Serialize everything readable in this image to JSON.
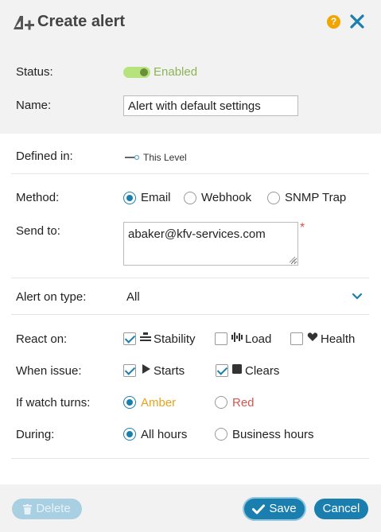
{
  "dialog": {
    "title": "Create alert",
    "help_icon": "question-icon",
    "close_icon": "close-icon"
  },
  "status": {
    "label": "Status:",
    "value": "Enabled",
    "enabled": true
  },
  "name": {
    "label": "Name:",
    "value": "Alert with default settings"
  },
  "defined_in": {
    "label": "Defined in:",
    "value": "This Level"
  },
  "method": {
    "label": "Method:",
    "options": [
      "Email",
      "Webhook",
      "SNMP Trap"
    ],
    "selected": "Email"
  },
  "send_to": {
    "label": "Send to:",
    "value": "abaker@kfv-services.com",
    "required_marker": "*"
  },
  "alert_on_type": {
    "label": "Alert on type:",
    "value": "All"
  },
  "react_on": {
    "label": "React on:",
    "options": [
      {
        "label": "Stability",
        "checked": true,
        "icon": "stability-icon"
      },
      {
        "label": "Load",
        "checked": false,
        "icon": "load-icon"
      },
      {
        "label": "Health",
        "checked": false,
        "icon": "heart-icon"
      }
    ]
  },
  "when_issue": {
    "label": "When issue:",
    "options": [
      {
        "label": "Starts",
        "checked": true,
        "icon": "play-icon"
      },
      {
        "label": "Clears",
        "checked": true,
        "icon": "stop-icon"
      }
    ]
  },
  "if_watch_turns": {
    "label": "If watch turns:",
    "options": [
      {
        "label": "Amber",
        "color": "#e8a317"
      },
      {
        "label": "Red",
        "color": "#d9534f"
      }
    ],
    "selected": "Amber"
  },
  "during": {
    "label": "During:",
    "options": [
      "All hours",
      "Business hours"
    ],
    "selected": "All hours"
  },
  "footer": {
    "delete_label": "Delete",
    "save_label": "Save",
    "cancel_label": "Cancel"
  },
  "colors": {
    "accent": "#1a7fae",
    "enabled_green": "#8cb454",
    "help": "#f0a500"
  }
}
